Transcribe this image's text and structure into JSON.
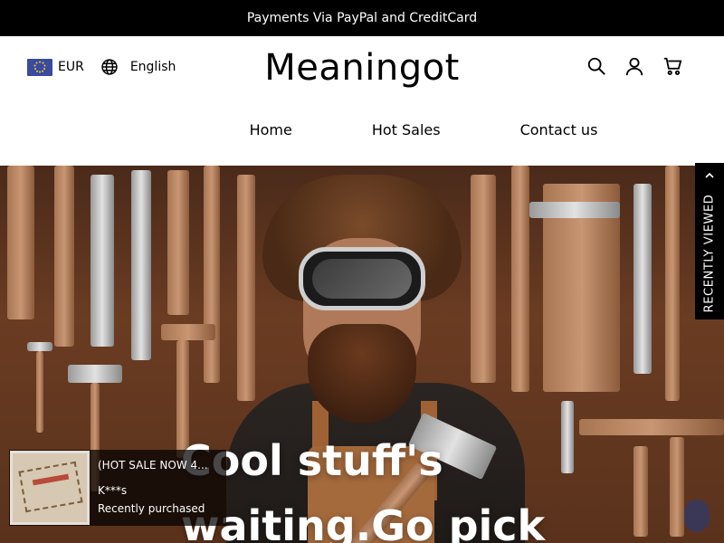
{
  "announcement": "Payments Via PayPal and CreditCard",
  "header": {
    "currency": "EUR",
    "language": "English",
    "logo": "Meaningot"
  },
  "nav": [
    "Home",
    "Hot Sales",
    "Contact us"
  ],
  "hero": {
    "headline_line1": "Cool stuff's",
    "headline_line2": "waiting.Go pick"
  },
  "recently_viewed": "RECENTLY VIEWED",
  "purchase_popup": {
    "title": "(HOT SALE NOW 4...",
    "buyer": "K***s",
    "status": "Recently purchased"
  },
  "icons": [
    "search-icon",
    "account-icon",
    "cart-icon",
    "globe-icon",
    "eu-flag-icon",
    "chevron-up-icon"
  ]
}
